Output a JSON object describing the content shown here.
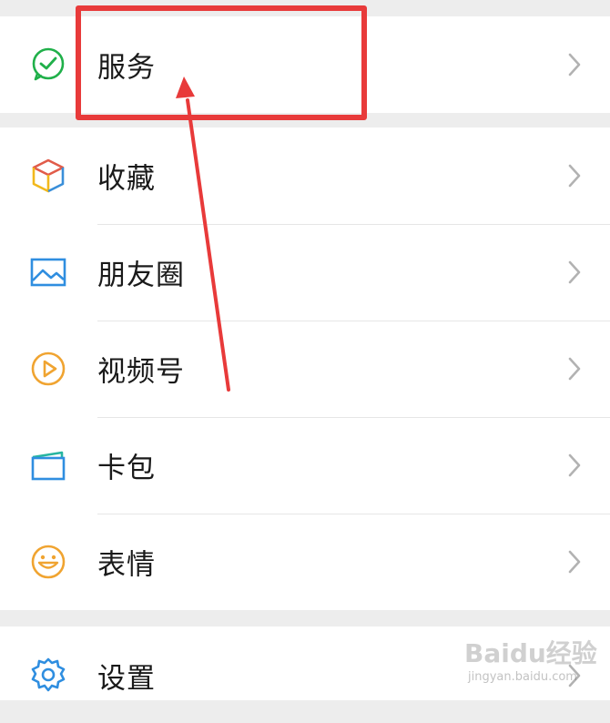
{
  "menu": {
    "items": [
      {
        "id": "service",
        "label": "服务",
        "icon": "wechat-pay-icon"
      },
      {
        "id": "favorites",
        "label": "收藏",
        "icon": "cube-icon"
      },
      {
        "id": "moments",
        "label": "朋友圈",
        "icon": "image-icon"
      },
      {
        "id": "channels",
        "label": "视频号",
        "icon": "play-circle-icon"
      },
      {
        "id": "cards",
        "label": "卡包",
        "icon": "wallet-icon"
      },
      {
        "id": "stickers",
        "label": "表情",
        "icon": "smiley-icon"
      },
      {
        "id": "settings",
        "label": "设置",
        "icon": "gear-icon"
      }
    ]
  },
  "annotation": {
    "highlight_color": "#e83a3a",
    "highlighted_item": "服务"
  },
  "watermark": {
    "text": "Baidu经验",
    "subtext": "jingyan.baidu.com"
  }
}
